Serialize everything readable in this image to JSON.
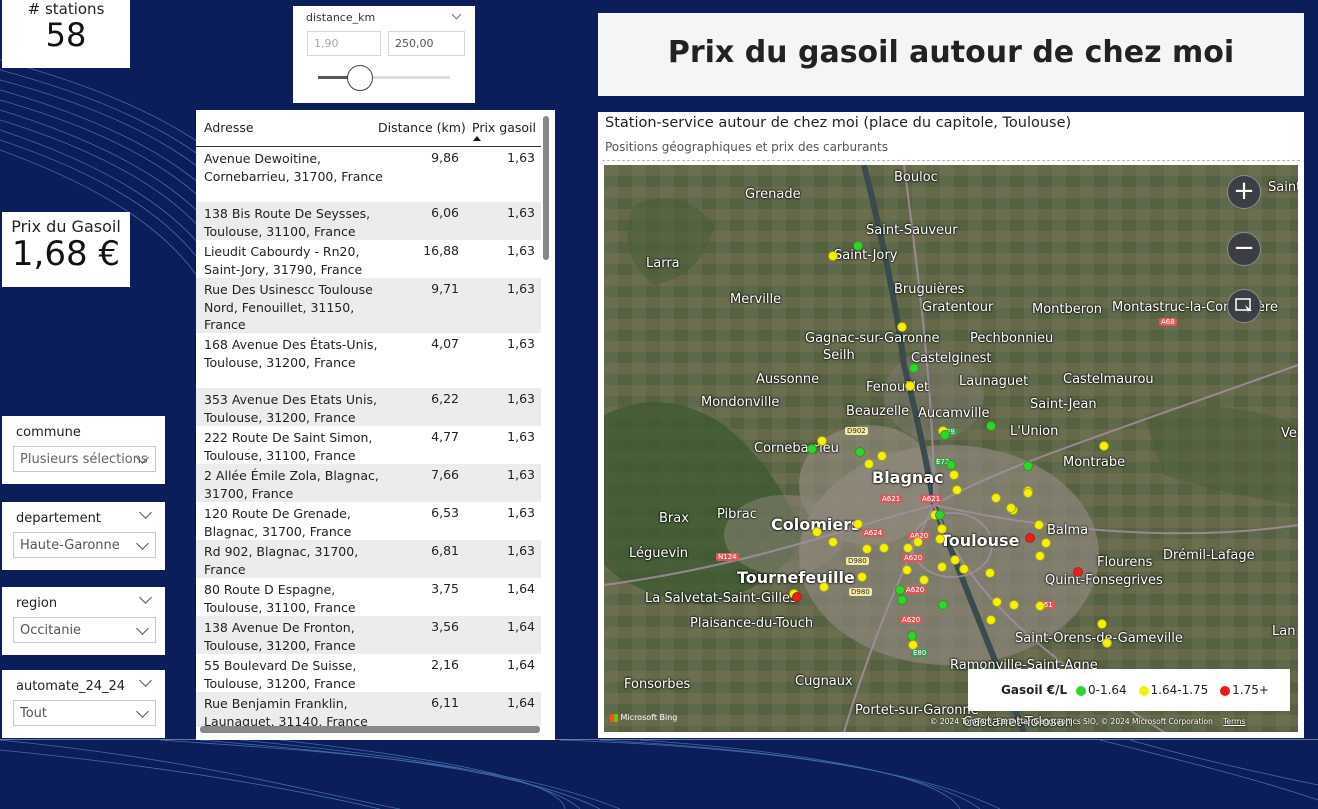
{
  "kpi_stations": {
    "title": "# stations",
    "value": "58"
  },
  "kpi_price": {
    "title": "Prix du Gasoil",
    "value": "1,68 €"
  },
  "distance_slicer": {
    "title": "distance_km",
    "min_value": "1,90",
    "max_value": "250,00",
    "slider_position": 0.1
  },
  "page_title": "Prix du gasoil autour de chez moi",
  "table": {
    "headers": [
      "Adresse",
      "Distance (km)",
      "Prix gasoil"
    ],
    "rows": [
      {
        "address": "Avenue Dewoitine, Cornebarrieu, 31700, France",
        "distance": "9,86",
        "price": "1,63"
      },
      {
        "address": "138 Bis Route De Seysses, Toulouse, 31100, France",
        "distance": "6,06",
        "price": "1,63"
      },
      {
        "address": "Lieudit Cabourdy - Rn20, Saint-Jory, 31790, France",
        "distance": "16,88",
        "price": "1,63"
      },
      {
        "address": "Rue Des Usinescc Toulouse Nord, Fenouillet, 31150, France",
        "distance": "9,71",
        "price": "1,63"
      },
      {
        "address": "168 Avenue Des États-Unis, Toulouse, 31200, France",
        "distance": "4,07",
        "price": "1,63"
      },
      {
        "address": "353 Avenue Des Etats Unis, Toulouse, 31200, France",
        "distance": "6,22",
        "price": "1,63"
      },
      {
        "address": "222 Route De Saint Simon, Toulouse, 31100, France",
        "distance": "4,77",
        "price": "1,63"
      },
      {
        "address": "2 Allée Émile Zola, Blagnac, 31700, France",
        "distance": "7,66",
        "price": "1,63"
      },
      {
        "address": "120 Route De Grenade, Blagnac, 31700, France",
        "distance": "6,53",
        "price": "1,63"
      },
      {
        "address": "Rd 902, Blagnac, 31700, France",
        "distance": "6,81",
        "price": "1,63"
      },
      {
        "address": "80 Route D Espagne, Toulouse, 31100, France",
        "distance": "3,75",
        "price": "1,64"
      },
      {
        "address": "138 Avenue De Fronton, Toulouse, 31200, France",
        "distance": "3,56",
        "price": "1,64"
      },
      {
        "address": "55 Boulevard De Suisse, Toulouse, 31200, France",
        "distance": "2,16",
        "price": "1,64"
      },
      {
        "address": "Rue Benjamin Franklin, Launaguet, 31140, France",
        "distance": "6,11",
        "price": "1,64"
      }
    ]
  },
  "slicers": {
    "commune": {
      "title": "commune",
      "value": "Plusieurs sélections"
    },
    "departement": {
      "title": "departement",
      "value": "Haute-Garonne"
    },
    "region": {
      "title": "region",
      "value": "Occitanie"
    },
    "automate": {
      "title": "automate_24_24",
      "value": "Tout"
    }
  },
  "map": {
    "title": "Station-service autour de chez moi (place du capitole, Toulouse)",
    "subtitle": "Positions géographiques et prix des carburants",
    "places": [
      "Bouloc",
      "Grenade",
      "Saint-Sauveur",
      "Saint-Jory",
      "Larra",
      "Bruguières",
      "Merville",
      "Gratentour",
      "Montberon",
      "Montastruc-la-Conseillère",
      "Gagnac-sur-Garonne",
      "Pechbonnieu",
      "Seilh",
      "Castelginest",
      "Aussonne",
      "Launaguet",
      "Castelmaurou",
      "Fenouillet",
      "Mondonville",
      "Beauzelle",
      "Aucamville",
      "Saint-Jean",
      "L'Union",
      "Cornebarrieu",
      "Montrabe",
      "Blagnac",
      "Brax",
      "Pibrac",
      "Colomiers",
      "Toulouse",
      "Balma",
      "Léguevin",
      "Flourens",
      "Drémil-Lafage",
      "Tournefeuille",
      "Quint-Fonsegrives",
      "La Salvetat-Saint-Gilles",
      "Plaisance-du-Touch",
      "Saint-Orens-de-Gameville",
      "Ramonville-Saint-Agne",
      "Fonsorbes",
      "Cugnaux",
      "Portet-sur-Garonne",
      "Castanet-Tolosan",
      "Saint-",
      "Lan",
      "Ve"
    ],
    "road_signs": [
      "A68",
      "D902",
      "E9",
      "E72",
      "A621",
      "A621",
      "A624",
      "A620",
      "A620",
      "N124",
      "D980",
      "A620",
      "D980",
      "E80",
      "A61",
      "A620"
    ],
    "legend": {
      "title": "Gasoil €/L",
      "items": [
        {
          "label": "0-1.64",
          "color": "#2fd42f"
        },
        {
          "label": "1.64-1.75",
          "color": "#f5f00a"
        },
        {
          "label": "1.75+",
          "color": "#e81e1e"
        }
      ]
    },
    "attribution": "© 2024 TomTom, Earthstar Geographics SIO, © 2024 Microsoft Corporation",
    "terms": "Terms",
    "bing": "Microsoft Bing",
    "zoom_in": "+",
    "zoom_out": "−"
  }
}
